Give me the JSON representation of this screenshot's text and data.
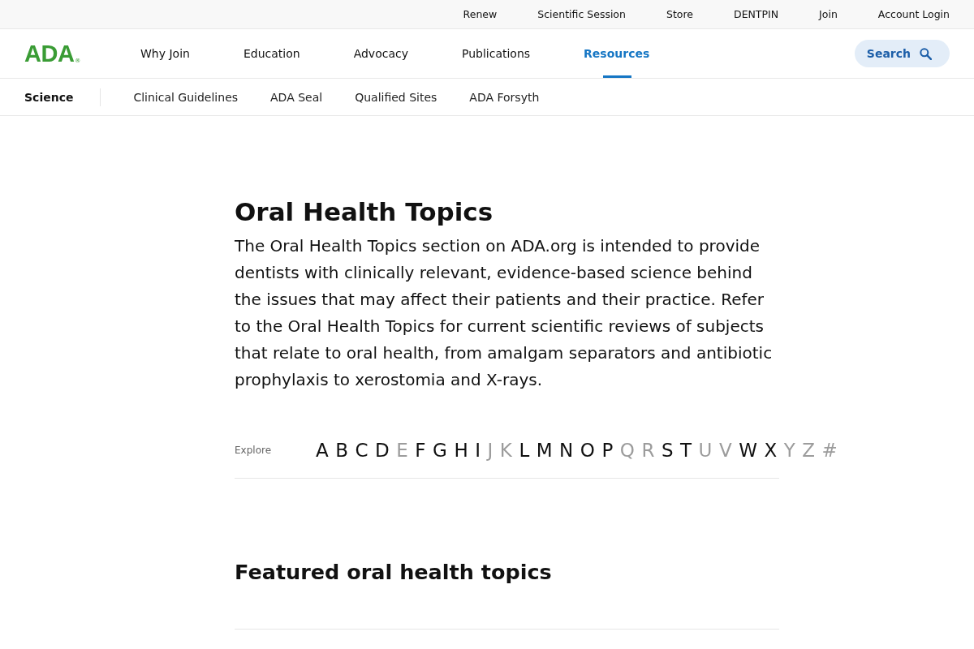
{
  "utility_bar": {
    "links": [
      "Renew",
      "Scientific Session",
      "Store",
      "DENTPIN",
      "Join",
      "Account Login"
    ]
  },
  "main_nav": {
    "logo": {
      "text": "ADA",
      "mark": "®"
    },
    "items": [
      {
        "label": "Why Join",
        "selected": false
      },
      {
        "label": "Education",
        "selected": false
      },
      {
        "label": "Advocacy",
        "selected": false
      },
      {
        "label": "Publications",
        "selected": false
      },
      {
        "label": "Resources",
        "selected": true
      }
    ],
    "search_button": "Search"
  },
  "sub_nav": {
    "section": "Science",
    "links": [
      "Clinical Guidelines",
      "ADA Seal",
      "Qualified Sites",
      "ADA Forsyth"
    ]
  },
  "intro": {
    "title": "Oral Health Topics",
    "description": "The Oral Health Topics section on ADA.org is intended to provide dentists with clinically relevant, evidence-based science behind the issues that may affect their patients and their practice. Refer to the Oral Health Topics for current scientific reviews of subjects that relate to oral health, from amalgam separators and antibiotic prophylaxis to xerostomia and X-rays."
  },
  "explore": {
    "label": "Explore",
    "letters": [
      {
        "letter": "A",
        "disabled": false
      },
      {
        "letter": "B",
        "disabled": false
      },
      {
        "letter": "C",
        "disabled": false
      },
      {
        "letter": "D",
        "disabled": false
      },
      {
        "letter": "E",
        "disabled": true
      },
      {
        "letter": "F",
        "disabled": false
      },
      {
        "letter": "G",
        "disabled": false
      },
      {
        "letter": "H",
        "disabled": false
      },
      {
        "letter": "I",
        "disabled": false
      },
      {
        "letter": "J",
        "disabled": true
      },
      {
        "letter": "K",
        "disabled": true
      },
      {
        "letter": "L",
        "disabled": false
      },
      {
        "letter": "M",
        "disabled": false
      },
      {
        "letter": "N",
        "disabled": false
      },
      {
        "letter": "O",
        "disabled": false
      },
      {
        "letter": "P",
        "disabled": false
      },
      {
        "letter": "Q",
        "disabled": true
      },
      {
        "letter": "R",
        "disabled": true
      },
      {
        "letter": "S",
        "disabled": false
      },
      {
        "letter": "T",
        "disabled": false
      },
      {
        "letter": "U",
        "disabled": true
      },
      {
        "letter": "V",
        "disabled": true
      },
      {
        "letter": "W",
        "disabled": false
      },
      {
        "letter": "X",
        "disabled": false
      },
      {
        "letter": "Y",
        "disabled": true
      },
      {
        "letter": "Z",
        "disabled": true
      },
      {
        "letter": "#",
        "disabled": true
      }
    ]
  },
  "featured": {
    "title": "Featured oral health topics"
  }
}
